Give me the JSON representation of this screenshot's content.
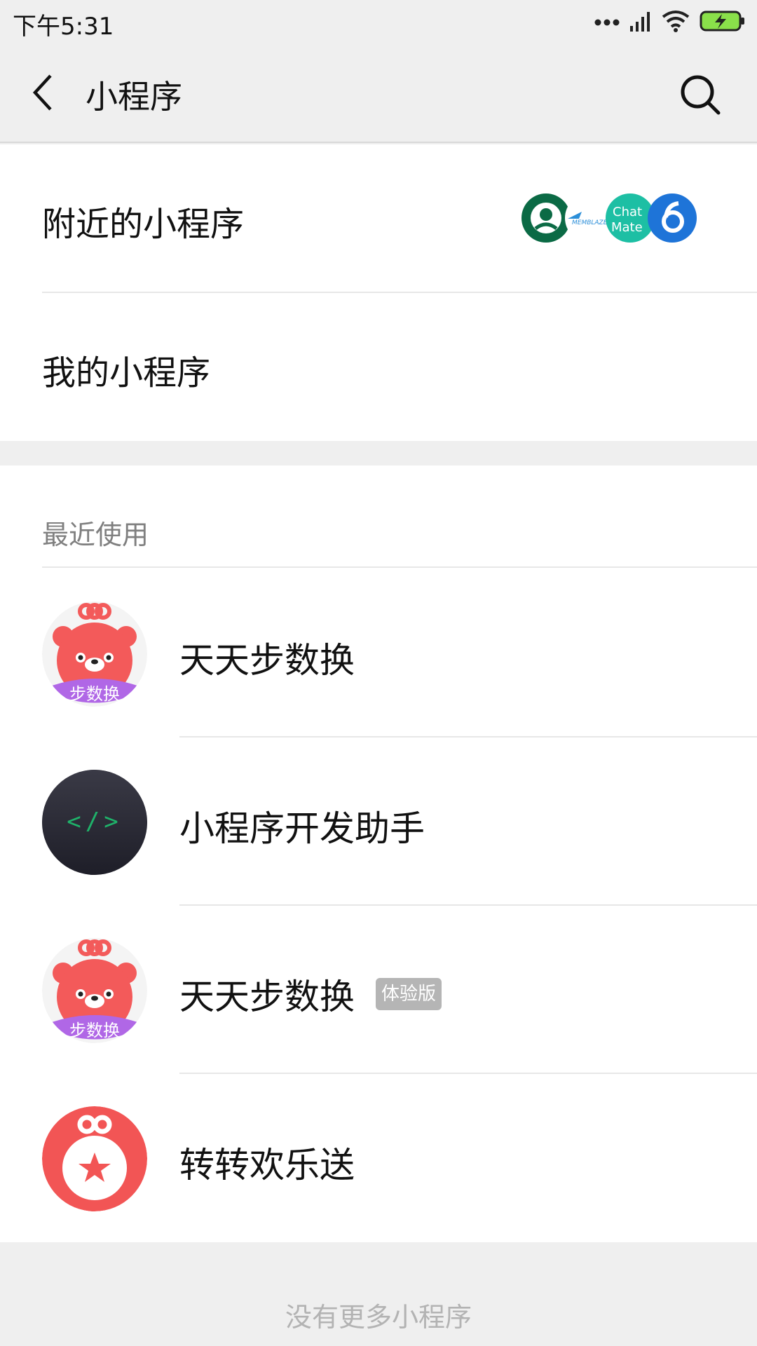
{
  "status": {
    "time": "下午5:31",
    "icons": [
      "dots-icon",
      "signal-icon",
      "wifi-icon",
      "battery-icon"
    ]
  },
  "header": {
    "title": "小程序",
    "back_icon": "back-arrow-icon",
    "search_icon": "search-icon"
  },
  "nearby": {
    "label": "附近的小程序",
    "logos": [
      "starbucks-logo",
      "memblaze-logo",
      "chatmate-logo",
      "blue-6-logo"
    ]
  },
  "mine": {
    "label": "我的小程序"
  },
  "recent": {
    "header": "最近使用",
    "items": [
      {
        "name": "天天步数换",
        "badge": "",
        "icon_text": "步数换",
        "icon": "pink-bear-icon"
      },
      {
        "name": "小程序开发助手",
        "badge": "",
        "icon_text": "</>",
        "icon": "code-icon"
      },
      {
        "name": "天天步数换",
        "badge": "体验版",
        "icon_text": "步数换",
        "icon": "pink-bear-icon"
      },
      {
        "name": "转转欢乐送",
        "badge": "",
        "icon_text": "",
        "icon": "star-bag-icon"
      }
    ]
  },
  "footer": {
    "text": "没有更多小程序"
  },
  "colors": {
    "background": "#efefef",
    "card": "#ffffff",
    "bear_red": "#f35a5a",
    "bear_purple": "#b067e6",
    "code_dark": "#2a2a35",
    "code_green": "#1fb26a",
    "badge_gray": "#b5b5b5"
  }
}
